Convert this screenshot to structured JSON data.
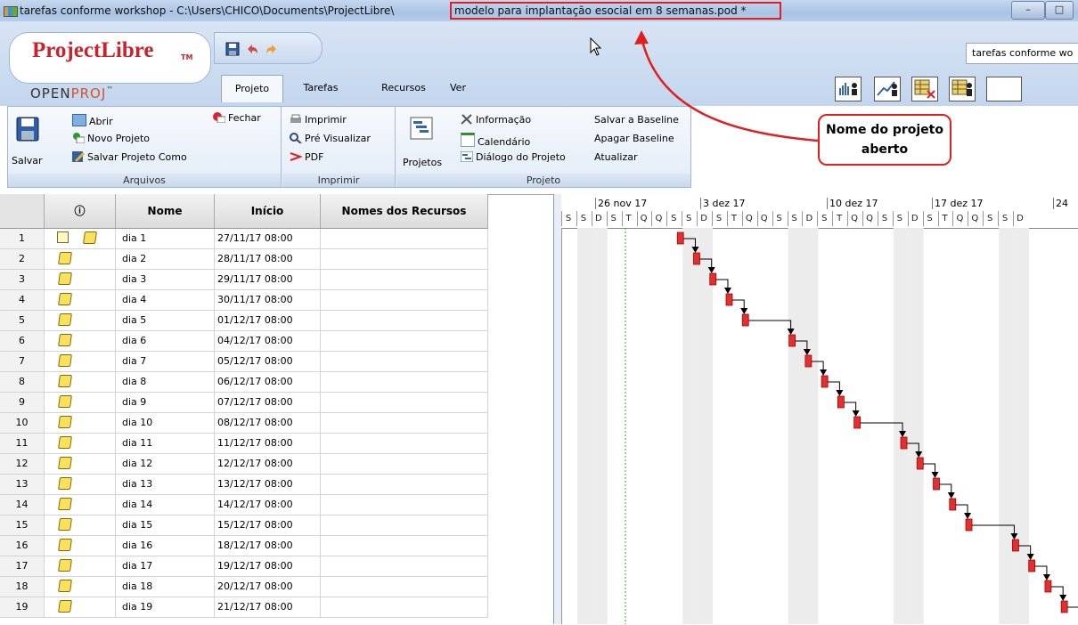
{
  "window": {
    "title_prefix": "tarefas conforme workshop - C:\\Users\\CHICO\\Documents\\ProjectLibre\\",
    "title_file": "modelo para implantação esocial em 8 semanas.pod *",
    "controls": [
      "–",
      "□"
    ]
  },
  "logo": {
    "name": "ProjectLibre",
    "tm": "TM",
    "sub_a": "OPEN",
    "sub_b": "PROJ",
    "sub_tm": "™"
  },
  "project_selector": {
    "value": "tarefas conforme wo"
  },
  "tabs": [
    {
      "label": "Projeto",
      "active": true
    },
    {
      "label": "Tarefas",
      "active": false
    },
    {
      "label": "Recursos",
      "active": false
    },
    {
      "label": "Ver",
      "active": false
    }
  ],
  "ribbon": {
    "arquivos": {
      "label": "Arquivos",
      "salvar": "Salvar",
      "abrir": "Abrir",
      "novo": "Novo Projeto",
      "salvar_como": "Salvar Projeto Como",
      "fechar": "Fechar"
    },
    "imprimir": {
      "label": "Imprimir",
      "imprimir": "Imprimir",
      "pre": "Pré Visualizar",
      "pdf": "PDF"
    },
    "projeto": {
      "label": "Projeto",
      "projetos": "Projetos",
      "informacao": "Informação",
      "calendario": "Calendário",
      "dialogo": "Diálogo do Projeto",
      "salvar_baseline": "Salvar a Baseline",
      "apagar_baseline": "Apagar Baseline",
      "atualizar": "Atualizar"
    }
  },
  "callout": {
    "line1": "Nome do projeto",
    "line2": "aberto"
  },
  "table": {
    "headers": {
      "num": "",
      "ind": "ⓘ",
      "name": "Nome",
      "start": "Início",
      "resources": "Nomes dos Recursos"
    },
    "rows": [
      {
        "num": "1",
        "name": "dia 1",
        "start": "27/11/17 08:00",
        "res": ""
      },
      {
        "num": "2",
        "name": "dia 2",
        "start": "28/11/17 08:00",
        "res": ""
      },
      {
        "num": "3",
        "name": "dia 3",
        "start": "29/11/17 08:00",
        "res": ""
      },
      {
        "num": "4",
        "name": "dia 4",
        "start": "30/11/17 08:00",
        "res": ""
      },
      {
        "num": "5",
        "name": "dia 5",
        "start": "01/12/17 08:00",
        "res": ""
      },
      {
        "num": "6",
        "name": "dia 6",
        "start": "04/12/17 08:00",
        "res": ""
      },
      {
        "num": "7",
        "name": "dia 7",
        "start": "05/12/17 08:00",
        "res": ""
      },
      {
        "num": "8",
        "name": "dia 8",
        "start": "06/12/17 08:00",
        "res": ""
      },
      {
        "num": "9",
        "name": "dia 9",
        "start": "07/12/17 08:00",
        "res": ""
      },
      {
        "num": "10",
        "name": "dia 10",
        "start": "08/12/17 08:00",
        "res": ""
      },
      {
        "num": "11",
        "name": "dia 11",
        "start": "11/12/17 08:00",
        "res": ""
      },
      {
        "num": "12",
        "name": "dia 12",
        "start": "12/12/17 08:00",
        "res": ""
      },
      {
        "num": "13",
        "name": "dia 13",
        "start": "13/12/17 08:00",
        "res": ""
      },
      {
        "num": "14",
        "name": "dia 14",
        "start": "14/12/17 08:00",
        "res": ""
      },
      {
        "num": "15",
        "name": "dia 15",
        "start": "15/12/17 08:00",
        "res": ""
      },
      {
        "num": "16",
        "name": "dia 16",
        "start": "18/12/17 08:00",
        "res": ""
      },
      {
        "num": "17",
        "name": "dia 17",
        "start": "19/12/17 08:00",
        "res": ""
      },
      {
        "num": "18",
        "name": "dia 18",
        "start": "20/12/17 08:00",
        "res": ""
      },
      {
        "num": "19",
        "name": "dia 19",
        "start": "21/12/17 08:00",
        "res": ""
      }
    ]
  },
  "gantt": {
    "weeks": [
      "26 nov 17",
      "3 dez 17",
      "10 dez 17",
      "17 dez 17",
      "24"
    ],
    "day_letters": [
      "S",
      "S",
      "D",
      "S",
      "T",
      "Q",
      "Q",
      "S",
      "S",
      "D",
      "S",
      "T",
      "Q",
      "Q",
      "S",
      "S",
      "D",
      "S",
      "T",
      "Q",
      "Q",
      "S",
      "S",
      "D",
      "S",
      "T",
      "Q",
      "Q",
      "S",
      "S",
      "D"
    ],
    "bar_color": "#e03030"
  }
}
